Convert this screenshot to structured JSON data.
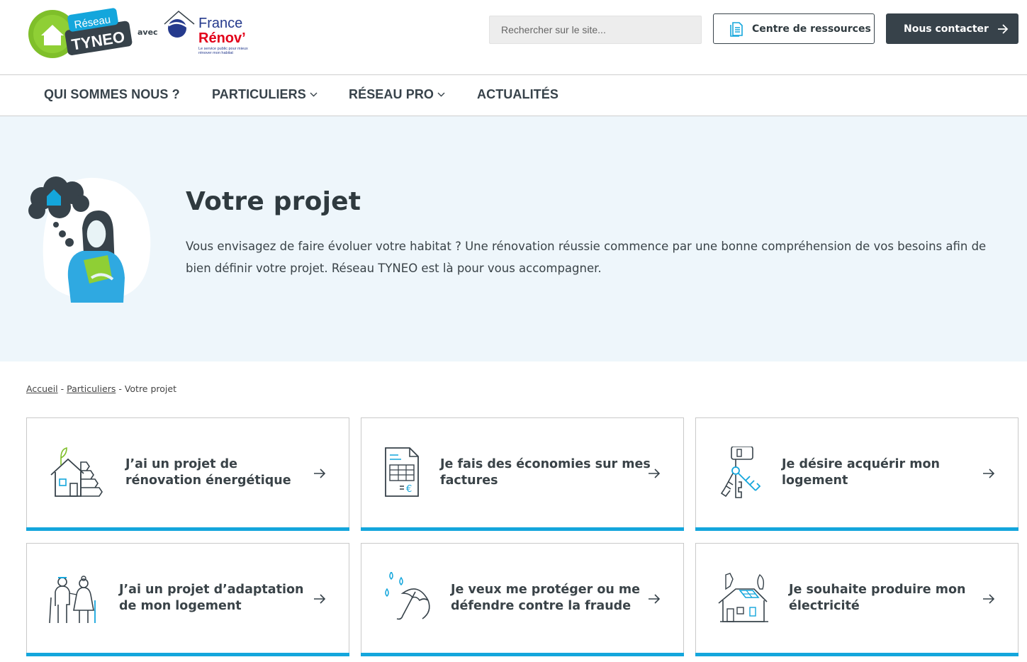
{
  "header": {
    "logo": {
      "tyneo_line1": "Réseau",
      "tyneo_line2": "TYNEO",
      "avec": "avec",
      "france_renov_line1": "France",
      "france_renov_line2": "Rénov’",
      "france_renov_tagline": "Le service public pour mieux rénover mon habitat"
    },
    "search_placeholder": "Rechercher sur le site...",
    "resources_label": "Centre de ressources",
    "contact_label": "Nous contacter"
  },
  "nav": {
    "items": [
      {
        "label": "QUI SOMMES NOUS ?",
        "has_dropdown": false
      },
      {
        "label": "PARTICULIERS",
        "has_dropdown": true
      },
      {
        "label": "RÉSEAU PRO",
        "has_dropdown": true
      },
      {
        "label": "ACTUALITÉS",
        "has_dropdown": false
      }
    ]
  },
  "hero": {
    "title": "Votre projet",
    "text": "Vous envisagez de faire évoluer votre habitat ? Une rénovation réussie commence par une bonne compréhension de vos besoins afin de bien définir votre projet. Réseau TYNEO est là pour vous accompagner."
  },
  "breadcrumb": {
    "home": "Accueil",
    "sep1": " - ",
    "section": "Particuliers",
    "sep2": " - ",
    "current": "Votre projet"
  },
  "cards": [
    {
      "label_line1": "J’ai un projet de",
      "label_line2": "rénovation énergétique",
      "icon": "house-energy-icon"
    },
    {
      "label_line1": "Je fais des économies sur mes",
      "label_line2": "factures",
      "icon": "invoice-icon"
    },
    {
      "label_line1": "Je désire acquérir mon",
      "label_line2": "logement",
      "icon": "keys-icon"
    },
    {
      "label_line1": "J’ai un projet d’adaptation",
      "label_line2": "de mon logement",
      "icon": "elderly-couple-icon"
    },
    {
      "label_line1": "Je veux me protéger ou me",
      "label_line2": "défendre contre la fraude",
      "icon": "umbrella-rain-icon"
    },
    {
      "label_line1": "Je souhaite produire mon",
      "label_line2": "électricité",
      "icon": "solar-house-icon"
    }
  ],
  "colors": {
    "accent": "#14a6dc",
    "dark": "#37424a",
    "hero_bg": "#eef6fb",
    "green": "#7fbf2a"
  }
}
